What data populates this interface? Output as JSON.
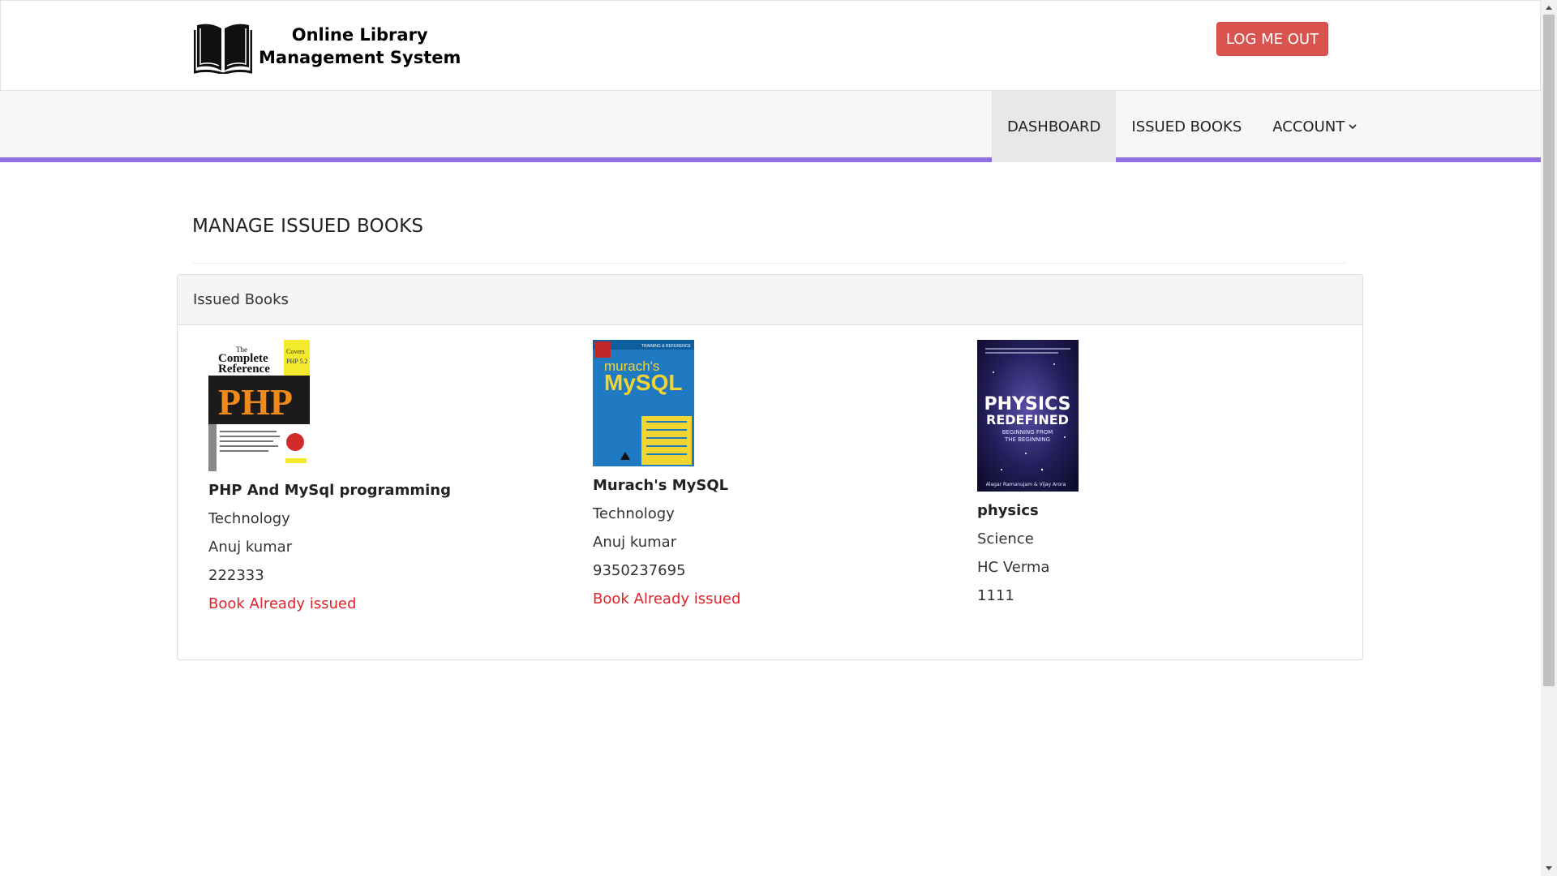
{
  "header": {
    "logo_line1": "Online Library",
    "logo_line2": "Management System",
    "logout_label": "LOG ME OUT"
  },
  "nav": {
    "items": [
      {
        "label": "DASHBOARD"
      },
      {
        "label": "ISSUED BOOKS"
      },
      {
        "label": "ACCOUNT"
      }
    ]
  },
  "main": {
    "page_title": "MANAGE ISSUED BOOKS",
    "panel_heading": "Issued Books",
    "books": [
      {
        "title": "PHP And MySql programming",
        "category": "Technology",
        "author": "Anuj kumar",
        "isbn": "222333",
        "status": "Book Already issued",
        "cover": {
          "line1": "The",
          "line2": "Complete",
          "line3": "Reference",
          "badge1": "Covers",
          "badge2": "PHP 5.2",
          "big": "PHP"
        }
      },
      {
        "title": "Murach's MySQL",
        "category": "Technology",
        "author": "Anuj kumar",
        "isbn": "9350237695",
        "status": "Book Already issued",
        "cover": {
          "top": "TRAINING & REFERENCE",
          "line1": "murach's",
          "big": "MySQL"
        }
      },
      {
        "title": "physics",
        "category": "Science",
        "author": "HC Verma",
        "isbn": "1111",
        "status": "",
        "cover": {
          "big1": "PHYSICS",
          "big2": "REDEFINED",
          "sub1": "BEGINNING FROM",
          "sub2": "THE BEGINNING",
          "authors": "Alagar Ramanujam & Vijay Arora"
        }
      }
    ]
  },
  "colors": {
    "accent": "#9170e4",
    "danger": "#d9534f",
    "status_red": "#e2222a"
  }
}
